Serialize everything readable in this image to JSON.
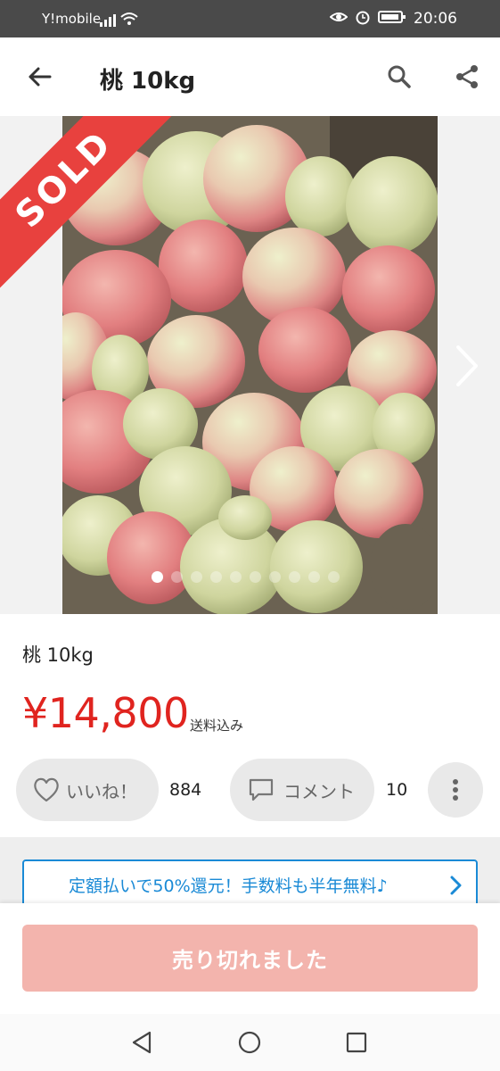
{
  "status_bar": {
    "carrier": "Y!mobile",
    "time": "20:06"
  },
  "header": {
    "title": "桃 10kg",
    "back_icon": "arrow-left-icon",
    "search_icon": "search-icon",
    "share_icon": "share-icon"
  },
  "gallery": {
    "sold_label": "SOLD",
    "image_count": 10,
    "active_index": 0,
    "next_icon": "chevron-right-icon"
  },
  "item": {
    "name": "桃 10kg",
    "price": "¥14,800",
    "shipping": "送料込み"
  },
  "actions": {
    "like_label": "いいね！",
    "like_count": "884",
    "comment_label": "コメント",
    "comment_count": "10",
    "more_icon": "more-vertical-icon"
  },
  "promo": {
    "text": "定額払いで50%還元！手数料も半年無料♪"
  },
  "purchase": {
    "button_label": "売り切れました"
  },
  "colors": {
    "price": "#e0241f",
    "sold_ribbon": "#e8413e",
    "sold_button": "#f3b4ad",
    "promo_accent": "#1a8ad6"
  }
}
